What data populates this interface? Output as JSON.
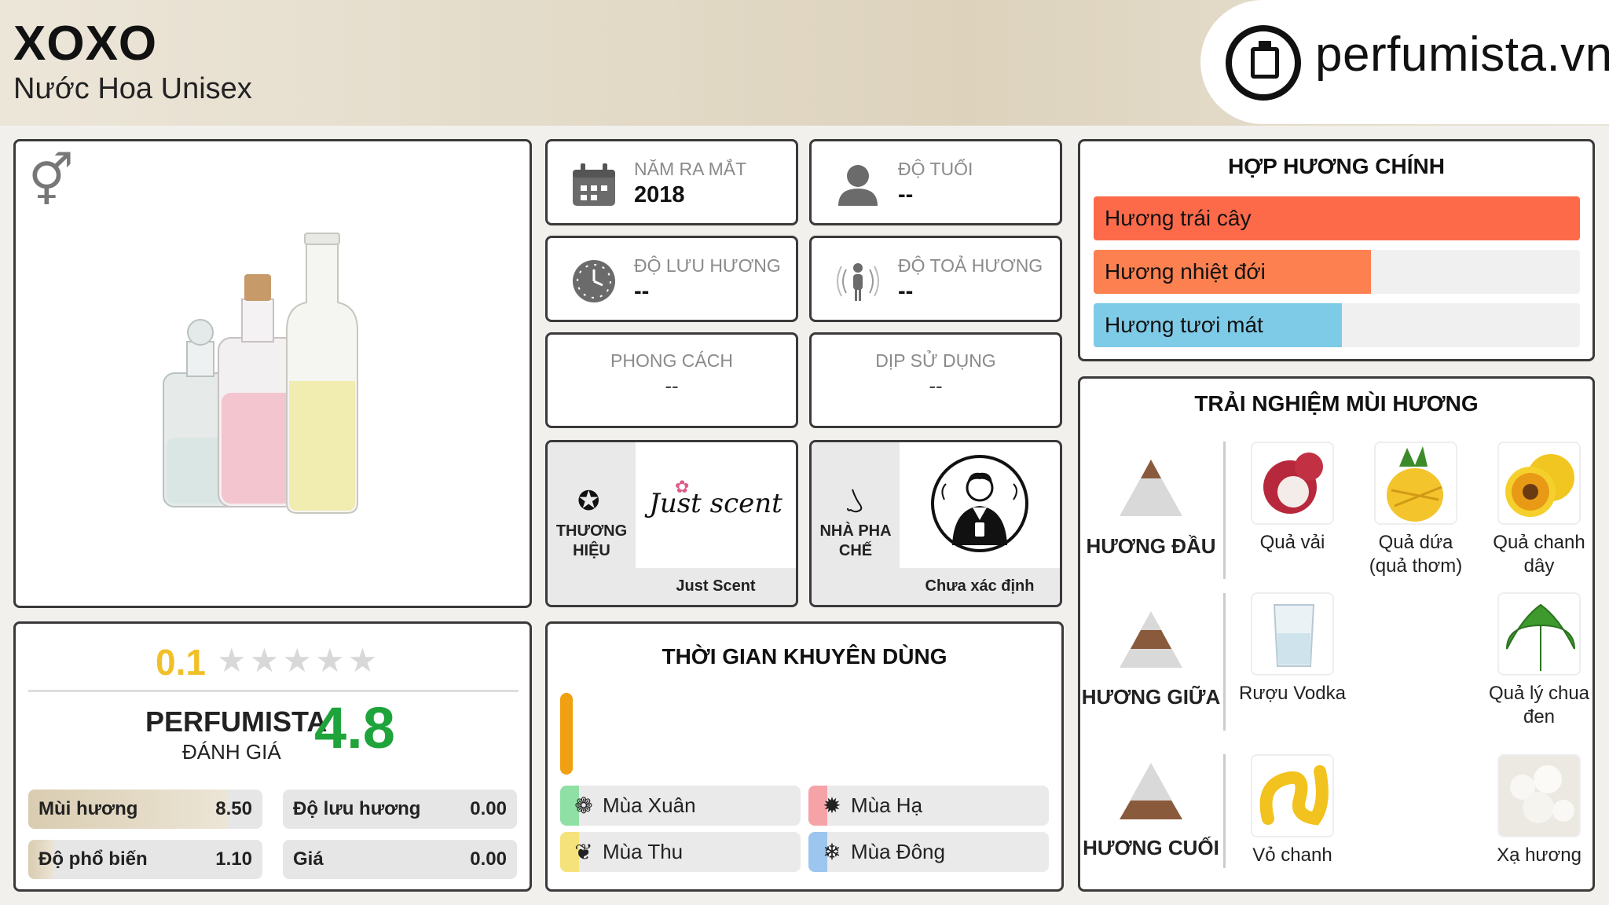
{
  "header": {
    "title": "XOXO",
    "subtitle": "Nước Hoa Unisex",
    "logo_text": "perfumista.vn"
  },
  "product": {
    "gender_icon": "unisex-gender-icon",
    "image": "perfume-bottles-image"
  },
  "info": {
    "launch_year": {
      "label": "NĂM RA MẮT",
      "value": "2018",
      "icon": "calendar-icon"
    },
    "age": {
      "label": "ĐỘ TUỔI",
      "value": "--",
      "icon": "person-icon"
    },
    "longevity": {
      "label": "ĐỘ LƯU HƯƠNG",
      "value": "--",
      "icon": "clock-icon"
    },
    "sillage": {
      "label": "ĐỘ TOẢ HƯƠNG",
      "value": "--",
      "icon": "radiating-person-icon"
    },
    "style": {
      "label": "PHONG CÁCH",
      "value": "--"
    },
    "occasion": {
      "label": "DỊP SỬ DỤNG",
      "value": "--"
    }
  },
  "brand": {
    "label_line1": "THƯƠNG",
    "label_line2": "HIỆU",
    "logo_text": "Just scent",
    "name": "Just Scent"
  },
  "perfumer": {
    "label_line1": "NHÀ PHA",
    "label_line2": "CHẾ",
    "name": "Chưa xác định"
  },
  "accords": {
    "title": "HỢP HƯƠNG CHÍNH",
    "items": [
      {
        "label": "Hương trái cây",
        "percent": 100,
        "color": "#fd6a4a"
      },
      {
        "label": "Hương nhiệt đới",
        "percent": 57,
        "color": "#fc8050"
      },
      {
        "label": "Hương tươi mát",
        "percent": 51,
        "color": "#7ecbe8"
      }
    ]
  },
  "notes": {
    "title": "TRẢI NGHIỆM MÙI HƯƠNG",
    "top": {
      "label": "HƯƠNG ĐẦU",
      "items": [
        {
          "line1": "Quả vải",
          "line2": ""
        },
        {
          "line1": "Quả dứa",
          "line2": "(quả thơm)"
        },
        {
          "line1": "Quả chanh",
          "line2": "dây"
        }
      ]
    },
    "middle": {
      "label": "HƯƠNG GIỮA",
      "items": [
        {
          "line1": "Rượu Vodka",
          "line2": ""
        },
        {
          "line1": "Quả lý chua",
          "line2": "đen"
        }
      ]
    },
    "base": {
      "label": "HƯƠNG CUỐI",
      "items": [
        {
          "line1": "Vỏ chanh",
          "line2": ""
        },
        {
          "line1": "Xạ hương",
          "line2": ""
        }
      ]
    }
  },
  "rating": {
    "user_score": "0.1",
    "user_stars": 0.1,
    "max_stars": 5,
    "perfumista_label": "PERFUMISTA",
    "perfumista_sub": "ĐÁNH GIÁ",
    "perfumista_score": "4.8",
    "metrics": [
      {
        "label": "Mùi hương",
        "value": "8.50",
        "fraction": 0.85
      },
      {
        "label": "Độ lưu hương",
        "value": "0.00",
        "fraction": 0
      },
      {
        "label": "Độ phổ biến",
        "value": "1.10",
        "fraction": 0.11
      },
      {
        "label": "Giá",
        "value": "0.00",
        "fraction": 0
      }
    ]
  },
  "seasons": {
    "title": "THỜI GIAN KHUYÊN DÙNG",
    "items": [
      {
        "label": "Mùa Xuân",
        "color": "#8fe0a4",
        "icon": "flower-icon"
      },
      {
        "label": "Mùa Hạ",
        "color": "#f6a3a8",
        "icon": "sun-icon"
      },
      {
        "label": "Mùa Thu",
        "color": "#f5e27a",
        "icon": "leaf-icon"
      },
      {
        "label": "Mùa Đông",
        "color": "#9cc6ee",
        "icon": "snowflake-icon"
      }
    ]
  }
}
